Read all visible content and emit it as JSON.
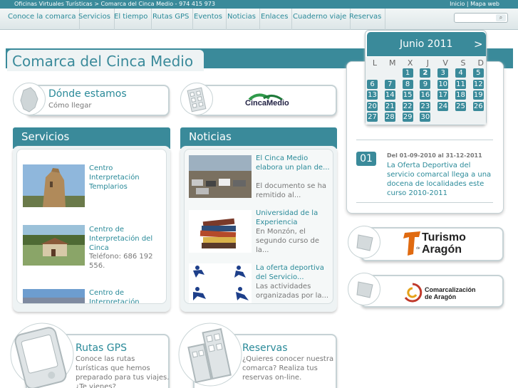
{
  "topbar": {
    "breadcrumb": "Oficinas Virtuales Turísticas > Comarca del Cinca Medio - 974 415 973",
    "links": "Inicio | Mapa web"
  },
  "nav": {
    "items": [
      "Conoce la comarca",
      "Servicios",
      "El tiempo",
      "Rutas GPS",
      "Eventos",
      "Noticias",
      "Enlaces",
      "Cuaderno viaje",
      "Reservas"
    ],
    "search_icon": "search-icon"
  },
  "page": {
    "title": "Comarca del Cinca Medio"
  },
  "calendar": {
    "month": "Junio 2011",
    "next": ">",
    "weekdays": [
      "L",
      "M",
      "X",
      "J",
      "V",
      "S",
      "D"
    ],
    "days": [
      "1",
      "2",
      "3",
      "4",
      "5",
      "6",
      "7",
      "8",
      "9",
      "10",
      "11",
      "12",
      "13",
      "14",
      "15",
      "16",
      "17",
      "18",
      "19",
      "20",
      "21",
      "22",
      "23",
      "24",
      "25",
      "26",
      "27",
      "28",
      "29",
      "30"
    ],
    "event": {
      "number": "01",
      "date": "Del 01-09-2010 al 31-12-2011",
      "text": "La Oferta Deportiva del servicio comarcal llega a una docena de localidades este curso 2010-2011"
    }
  },
  "cards": {
    "donde": {
      "title": "Dónde estamos",
      "subtitle": "Cómo llegar"
    },
    "cinca_logo": "CincaMedio",
    "rutas": {
      "title": "Rutas GPS",
      "text": "Conoce las rutas turísticas que hemos preparado para tus viajes. ¿Te vienes?"
    },
    "reservas": {
      "title": "Reservas",
      "text": "¿Quieres conocer nuestra comarca? Realiza tus reservas on-line."
    },
    "turismo_logo": {
      "line1": "Turismo",
      "line2": "Aragón",
      "de": "de"
    },
    "comarcalizacion_logo": {
      "line1": "Comarcalización",
      "line2": "de Aragón"
    }
  },
  "servicios": {
    "title": "Servicios",
    "items": [
      {
        "name": "Centro Interpretación Templarios",
        "extra": ""
      },
      {
        "name": "Centro de Interpretación del Cinca",
        "extra": "Teléfono: 686 192 556."
      },
      {
        "name": "Centro de Interpretación",
        "extra": ""
      }
    ]
  },
  "noticias": {
    "title": "Noticias",
    "items": [
      {
        "title": "El Cinca Medio elabora un plan de...",
        "excerpt": "El documento se ha remitido al..."
      },
      {
        "title": "Universidad de la Experiencia",
        "excerpt": "En Monzón, el segundo curso de la..."
      },
      {
        "title": "La oferta deportiva del Servicio...",
        "excerpt": "Las actividades organizadas por la..."
      }
    ]
  },
  "colors": {
    "accent": "#3a8a9a",
    "link": "#2a8a99"
  }
}
